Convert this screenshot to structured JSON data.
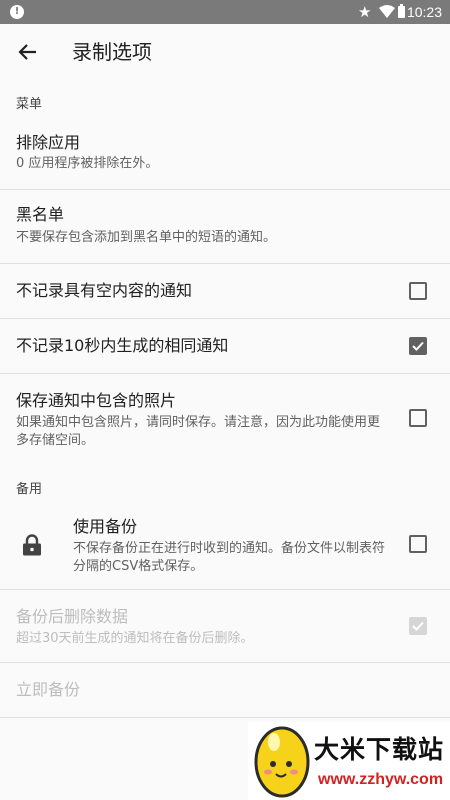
{
  "status_bar": {
    "time": "10:23",
    "notification_glyph": "!",
    "icons": [
      "alert-icon",
      "star-icon",
      "wifi-icon",
      "battery-icon"
    ]
  },
  "toolbar": {
    "back_icon": "arrow-left-icon",
    "title": "录制选项"
  },
  "sections": {
    "menu_header": "菜单",
    "backup_header": "备用"
  },
  "items": {
    "exclude_apps": {
      "title": "排除应用",
      "summary": "0 应用程序被排除在外。"
    },
    "blacklist": {
      "title": "黑名单",
      "summary": "不要保存包含添加到黑名单中的短语的通知。"
    },
    "no_empty": {
      "title": "不记录具有空内容的通知",
      "checked": false
    },
    "no_duplicate": {
      "title": "不记录10秒内生成的相同通知",
      "checked": true
    },
    "save_photos": {
      "title": "保存通知中包含的照片",
      "summary": "如果通知中包含照片，请同时保存。请注意，因为此功能使用更多存储空间。",
      "checked": false
    },
    "use_backup": {
      "title": "使用备份",
      "summary": "不保存备份正在进行时收到的通知。备份文件以制表符分隔的CSV格式保存。",
      "checked": false,
      "icon": "lock-icon"
    },
    "delete_after_backup": {
      "title": "备份后删除数据",
      "summary": "超过30天前生成的通知将在备份后删除。",
      "checked": true,
      "enabled": false
    },
    "backup_now": {
      "title": "立即备份",
      "enabled": false
    }
  },
  "watermark": {
    "name": "大米下载站",
    "url": "www.zzhyw.com"
  },
  "colors": {
    "status_bar": "#7a7a7a",
    "background": "#fafafa",
    "divider": "#e0e0e0",
    "text_primary": "#212121",
    "text_secondary": "#616161",
    "text_disabled": "#bdbdbd",
    "watermark_url": "#d32222"
  }
}
